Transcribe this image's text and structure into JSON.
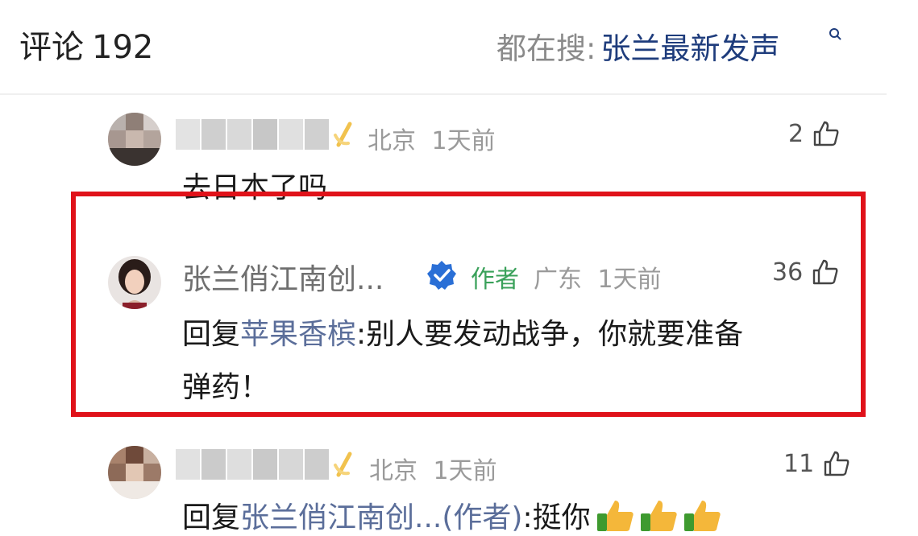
{
  "header": {
    "title": "评论",
    "count": "192",
    "hot_prefix": "都在搜:",
    "hot_keyword": "张兰最新发声"
  },
  "comments": [
    {
      "username_blurred": true,
      "location": "北京",
      "time": "1天前",
      "likes": "2",
      "text": "去日本了吗"
    },
    {
      "username": "张兰俏江南创...",
      "verified": true,
      "author_tag": "作者",
      "location": "广东",
      "time": "1天前",
      "likes": "36",
      "reply_prefix": "回复",
      "reply_to": "苹果香槟",
      "text_line1": ":别人要发动战争，你就要准备",
      "text_line2": "弹药！"
    },
    {
      "username_blurred": true,
      "location": "北京",
      "time": "1天前",
      "likes": "11",
      "reply_prefix": "回复",
      "reply_to": "张兰俏江南创...(作者)",
      "text": ":挺你"
    }
  ],
  "icons": {
    "like": "thumb-up-outline-icon",
    "verified": "verified-badge-icon",
    "search": "search-icon",
    "emoji": "thumbs-up-emoji-icon"
  },
  "colors": {
    "highlight_border": "#e0121a",
    "keyword": "#1e3c7c",
    "link": "#5b6e9a",
    "author_tag": "#3aa15a",
    "verified_badge": "#2a6fd6"
  }
}
